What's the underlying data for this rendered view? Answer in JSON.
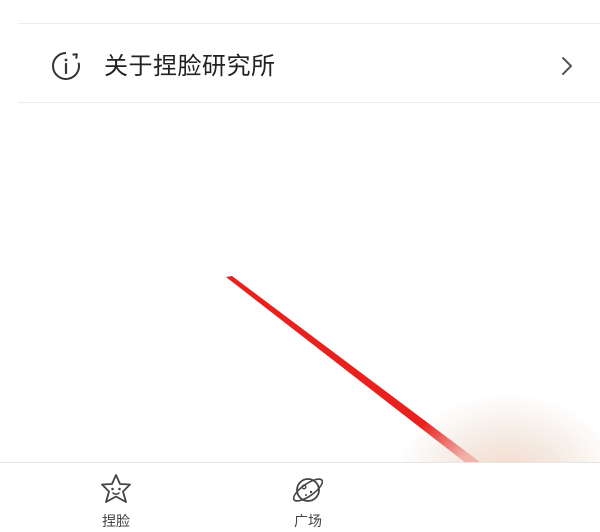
{
  "settings_item": {
    "label": "关于捏脸研究所",
    "icon": "info-icon",
    "chevron": "chevron-right-icon"
  },
  "tabbar": {
    "tabs": [
      {
        "label": "捏脸",
        "icon": "star-face-icon"
      },
      {
        "label": "广场",
        "icon": "planet-icon"
      }
    ]
  },
  "colors": {
    "annotation_arrow": "#e8201e",
    "text": "#222222",
    "divider": "#ededed"
  }
}
